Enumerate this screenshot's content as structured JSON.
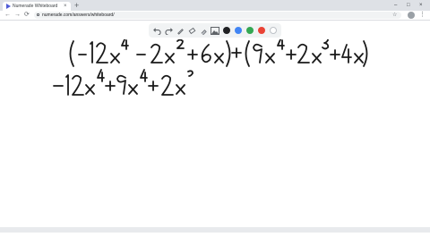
{
  "browser": {
    "tab_title": "Numerade Whiteboard",
    "tab_close": "×",
    "new_tab": "+",
    "url": "numerade.com/answers/whiteboard/",
    "window_controls": {
      "minimize": "–",
      "maximize": "□",
      "close": "×"
    },
    "nav": {
      "back": "←",
      "forward": "→",
      "reload": "⟳"
    },
    "bookmark_star": "☆",
    "menu": "⋮"
  },
  "whiteboard": {
    "tools": [
      "undo-icon",
      "redo-icon",
      "pen-icon",
      "eraser-icon",
      "highlighter-icon",
      "image-icon"
    ],
    "colors": [
      "#202124",
      "#4285f4",
      "#34a853",
      "#ea4335",
      "#ffffff"
    ],
    "handwriting": {
      "line1": "(−12x⁴ − 2x² + 6x) + (9x⁴ + 2x³ + 4x)",
      "line2": "−12x⁴ + 9x⁴ + 2x³"
    }
  }
}
